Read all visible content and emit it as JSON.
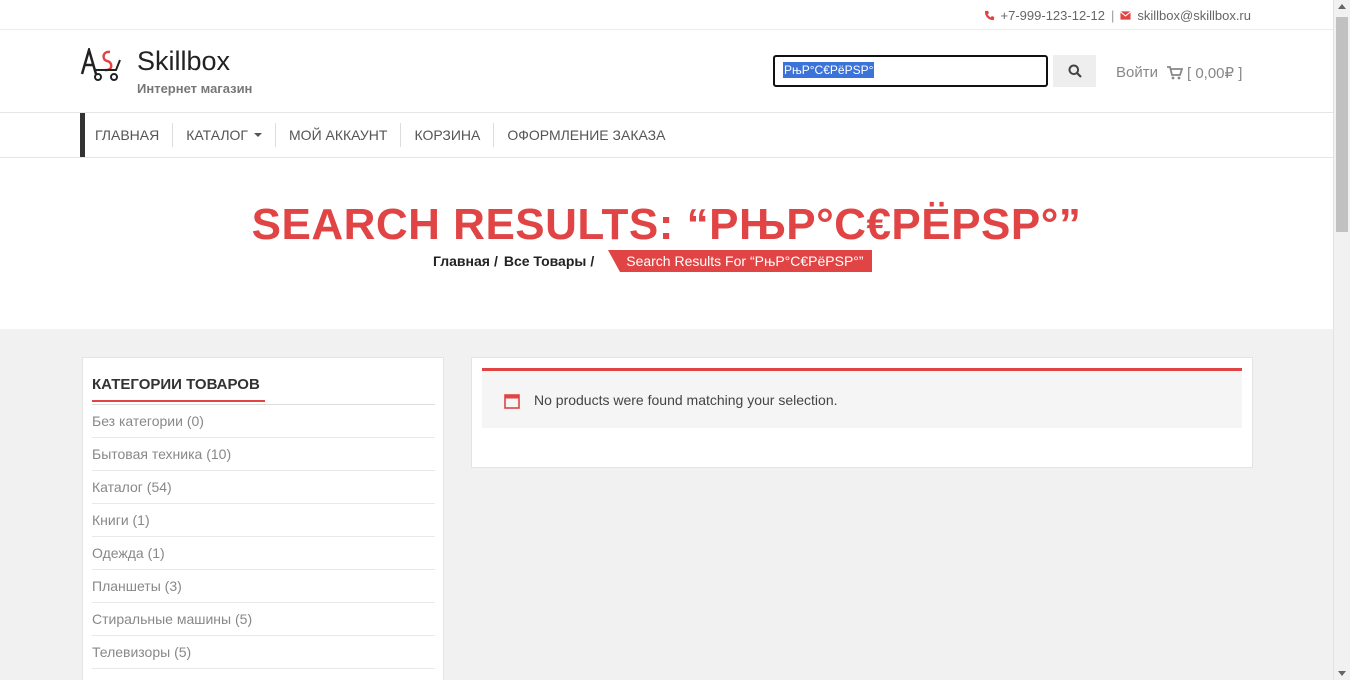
{
  "topbar": {
    "phone": "+7-999-123-12-12",
    "separator": "|",
    "email": "skillbox@skillbox.ru",
    "phone_icon": "phone-icon",
    "email_icon": "envelope-icon"
  },
  "header": {
    "brand": "Skillbox",
    "tagline": "Интернет магазин",
    "search_value": "РњР°С€РёРЅР°",
    "search_icon": "search-icon",
    "login_label": "Войти",
    "cart_label": "[ 0,00₽ ]",
    "cart_icon": "cart-icon"
  },
  "nav": {
    "items": [
      {
        "label": "ГЛАВНАЯ"
      },
      {
        "label": "КАТАЛОГ"
      },
      {
        "label": "МОЙ АККАУНТ"
      },
      {
        "label": "КОРЗИНА"
      },
      {
        "label": "ОФОРМЛЕНИЕ ЗАКАЗА"
      }
    ]
  },
  "hero": {
    "title": "SEARCH RESULTS: “РЊР°С€РЁРЅР°”",
    "crumbs": [
      "Главная",
      "Все Товары"
    ],
    "crumb_sep": "/",
    "current": "Search Results For “РњР°С€РёРЅР°”"
  },
  "sidebar": {
    "title": "КАТЕГОРИИ ТОВАРОВ",
    "items": [
      {
        "label": "Без категории (0)"
      },
      {
        "label": "Бытовая техника (10)"
      },
      {
        "label": "Каталог (54)"
      },
      {
        "label": "Книги (1)"
      },
      {
        "label": "Одежда (1)"
      },
      {
        "label": "Планшеты (3)"
      },
      {
        "label": "Стиральные машины (5)"
      },
      {
        "label": "Телевизоры (5)"
      }
    ]
  },
  "main": {
    "notice": "No products were found matching your selection.",
    "notice_icon": "calendar-icon"
  },
  "colors": {
    "accent": "#e04444",
    "dark": "#333333"
  }
}
